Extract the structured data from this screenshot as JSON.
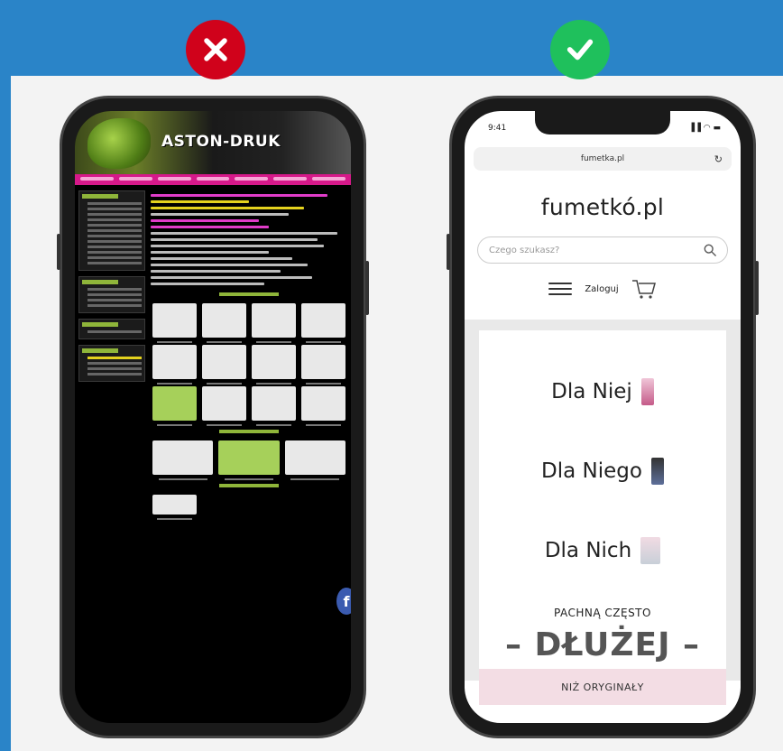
{
  "badges": {
    "bad": "x-icon",
    "good": "check-icon",
    "bad_color": "#d0021b",
    "good_color": "#1fc05c"
  },
  "left_site": {
    "logo_text": "ASTON-DRUK",
    "facebook_glyph": "f"
  },
  "right_site": {
    "status_time": "9:41",
    "status_icons": "▐▐ ◠ ▬",
    "url": "fumetka.pl",
    "reload_glyph": "↻",
    "brand": "fumetkó.pl",
    "search_placeholder": "Czego szukasz?",
    "login_label": "Zaloguj",
    "categories": [
      {
        "label": "Dla Niej"
      },
      {
        "label": "Dla Niego"
      },
      {
        "label": "Dla Nich"
      }
    ],
    "slogan_top": "PACHNĄ CZĘSTO",
    "slogan_main": "– DŁUŻEJ –",
    "slogan_bottom": "NIŻ ORYGINAŁY"
  }
}
